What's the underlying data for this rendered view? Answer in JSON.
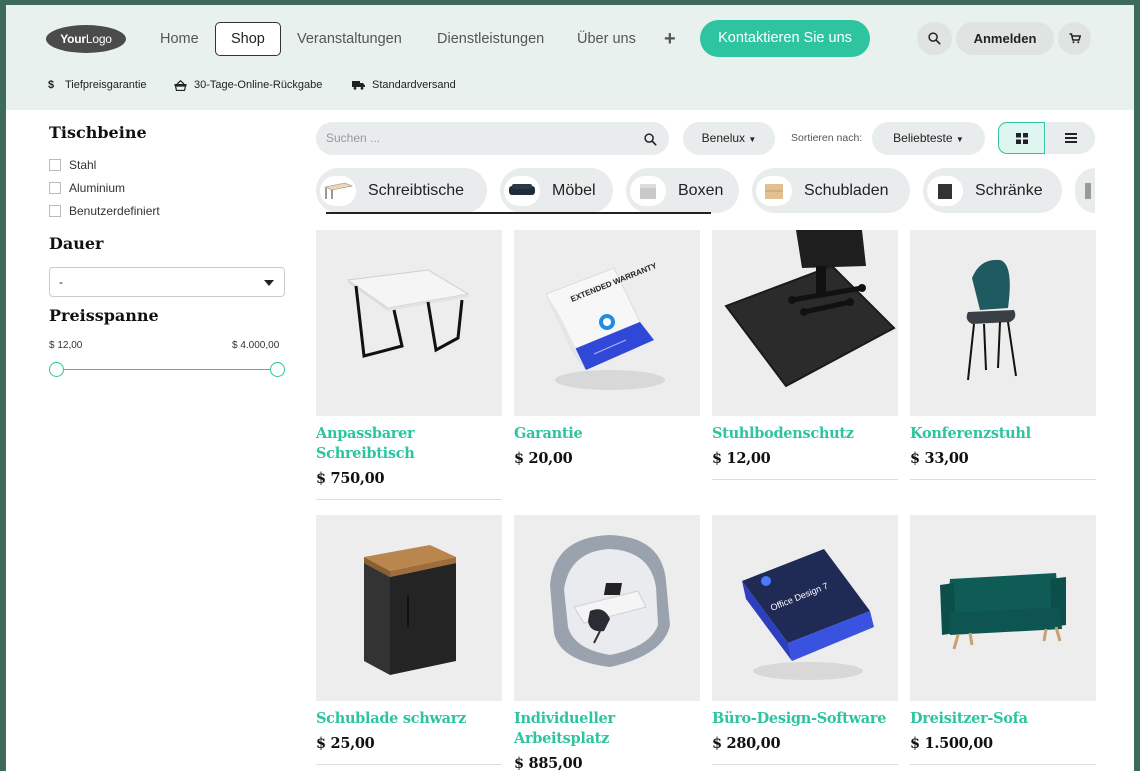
{
  "header": {
    "logo": {
      "your": "Your",
      "logo": "Logo"
    },
    "nav": [
      "Home",
      "Shop",
      "Veranstaltungen",
      "Dienstleistungen",
      "Über uns"
    ],
    "active_nav": "Shop",
    "contact_label": "Kontaktieren Sie uns",
    "login_label": "Anmelden",
    "accent_color": "#2ec4a0"
  },
  "perks": [
    "Tiefpreisgarantie",
    "30-Tage-Online-Rückgabe",
    "Standardversand"
  ],
  "sidebar": {
    "legs_title": "Tischbeine",
    "legs_options": [
      "Stahl",
      "Aluminium",
      "Benutzerdefiniert"
    ],
    "duration_title": "Dauer",
    "duration_value": "-",
    "price_title": "Preisspanne",
    "price_min": "$ 12,00",
    "price_max": "$ 4.000,00"
  },
  "toolbar": {
    "search_placeholder": "Suchen ...",
    "region": "Benelux",
    "sort_label": "Sortieren nach:",
    "sort_value": "Beliebteste"
  },
  "categories": [
    "Schreibtische",
    "Möbel",
    "Boxen",
    "Schubladen",
    "Schränke"
  ],
  "products": [
    {
      "name": "Anpassbarer Schreibtisch",
      "price": "$ 750,00"
    },
    {
      "name": "Garantie",
      "price": "$ 20,00"
    },
    {
      "name": "Stuhlbodenschutz",
      "price": "$ 12,00"
    },
    {
      "name": "Konferenzstuhl",
      "price": "$ 33,00"
    },
    {
      "name": "Schublade schwarz",
      "price": "$ 25,00"
    },
    {
      "name": "Individueller Arbeitsplatz",
      "price": "$ 885,00"
    },
    {
      "name": "Büro-Design-Software",
      "price": "$ 280,00"
    },
    {
      "name": "Dreisitzer-Sofa",
      "price": "$ 1.500,00"
    }
  ],
  "product_art": {
    "warranty_text": "EXTENDED WARRANTY",
    "software_text": "Office Design 7"
  }
}
